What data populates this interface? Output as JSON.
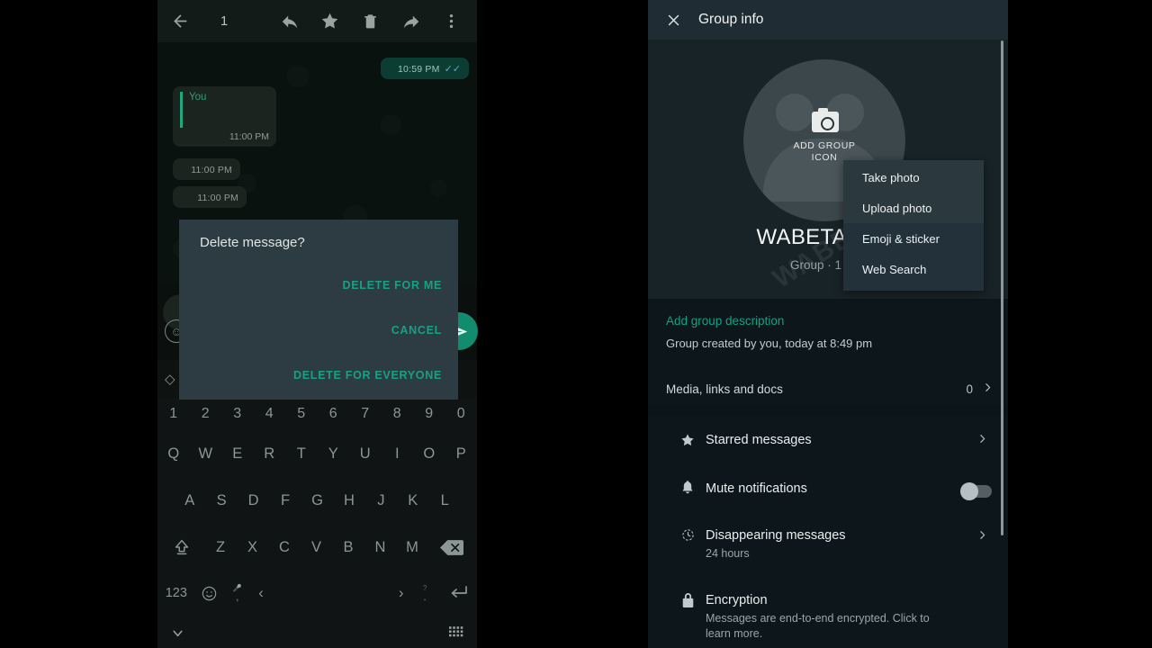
{
  "left": {
    "toolbar": {
      "back_icon": "arrow-left-icon",
      "selection_count": "1",
      "reply_icon": "reply-arrow-icon",
      "star_icon": "star-icon",
      "delete_icon": "trash-icon",
      "forward_icon": "forward-arrow-icon",
      "overflow_icon": "more-vertical-icon"
    },
    "messages": [
      {
        "side": "out",
        "time": "10:59 PM",
        "ticks": "✓✓"
      },
      {
        "side": "in",
        "quote_author": "You",
        "time": "11:00 PM"
      },
      {
        "side": "in",
        "time": "11:00 PM"
      },
      {
        "side": "in",
        "time": "11:00 PM"
      }
    ],
    "dialog": {
      "title": "Delete message?",
      "delete_for_me": "DELETE FOR ME",
      "cancel": "CANCEL",
      "delete_for_everyone": "DELETE FOR EVERYONE"
    },
    "keyboard": {
      "row_numbers": [
        "1",
        "2",
        "3",
        "4",
        "5",
        "6",
        "7",
        "8",
        "9",
        "0"
      ],
      "row_1": [
        "Q",
        "W",
        "E",
        "R",
        "T",
        "Y",
        "U",
        "I",
        "O",
        "P"
      ],
      "row_2": [
        "A",
        "S",
        "D",
        "F",
        "G",
        "H",
        "J",
        "K",
        "L"
      ],
      "row_3": [
        "Z",
        "X",
        "C",
        "V",
        "B",
        "N",
        "M"
      ],
      "shift_icon": "shift-up-icon",
      "backspace_icon": "backspace-icon",
      "numeric_key": "123",
      "emoji_icon": "emoji-smiley-icon",
      "comma_key": ",",
      "comma_alt": "mic-icon",
      "comma_left": "‹",
      "period_key": ".",
      "period_alt": "question-icon",
      "period_right": "›",
      "enter_icon": "enter-return-icon"
    },
    "navbar": {
      "hide_keyboard_icon": "chevron-down-icon",
      "keyboard_switch_icon": "keyboard-grid-icon"
    },
    "composer": {
      "emoji_icon": "emoji-icon",
      "send_icon": "send-icon"
    }
  },
  "right": {
    "toolbar": {
      "close_icon": "close-x-icon",
      "title": "Group info"
    },
    "avatar": {
      "icon": "group-avatar-icon",
      "camera_icon": "camera-icon",
      "label_line1": "ADD GROUP",
      "label_line2": "ICON"
    },
    "group_name": "WABETAINFO",
    "group_subtitle": "Group · 1 part",
    "description_link": "Add group description",
    "created_text": "Group created by you, today at 8:49 pm",
    "media_row": {
      "label": "Media, links and docs",
      "count": "0",
      "chevron": "chevron-right-icon"
    },
    "items": [
      {
        "icon": "star-icon",
        "title": "Starred messages",
        "subtitle": "",
        "accessory": "chevron"
      },
      {
        "icon": "bell-icon",
        "title": "Mute notifications",
        "subtitle": "",
        "accessory": "toggle",
        "toggle_on": false
      },
      {
        "icon": "timer-clock-icon",
        "title": "Disappearing messages",
        "subtitle": "24 hours",
        "accessory": "chevron"
      },
      {
        "icon": "lock-icon",
        "title": "Encryption",
        "subtitle": "Messages are end-to-end encrypted. Click to learn more.",
        "accessory": "none"
      }
    ],
    "context_menu": [
      "Take photo",
      "Upload photo",
      "Emoji & sticker",
      "Web Search"
    ],
    "watermark": "WABETAINFO"
  },
  "colors": {
    "accent_teal": "#12a183",
    "dialog_bg": "#2d3b42",
    "outgoing_bubble": "#0b3d32",
    "panel_bg": "#0d171b",
    "header_bg": "#182328"
  }
}
